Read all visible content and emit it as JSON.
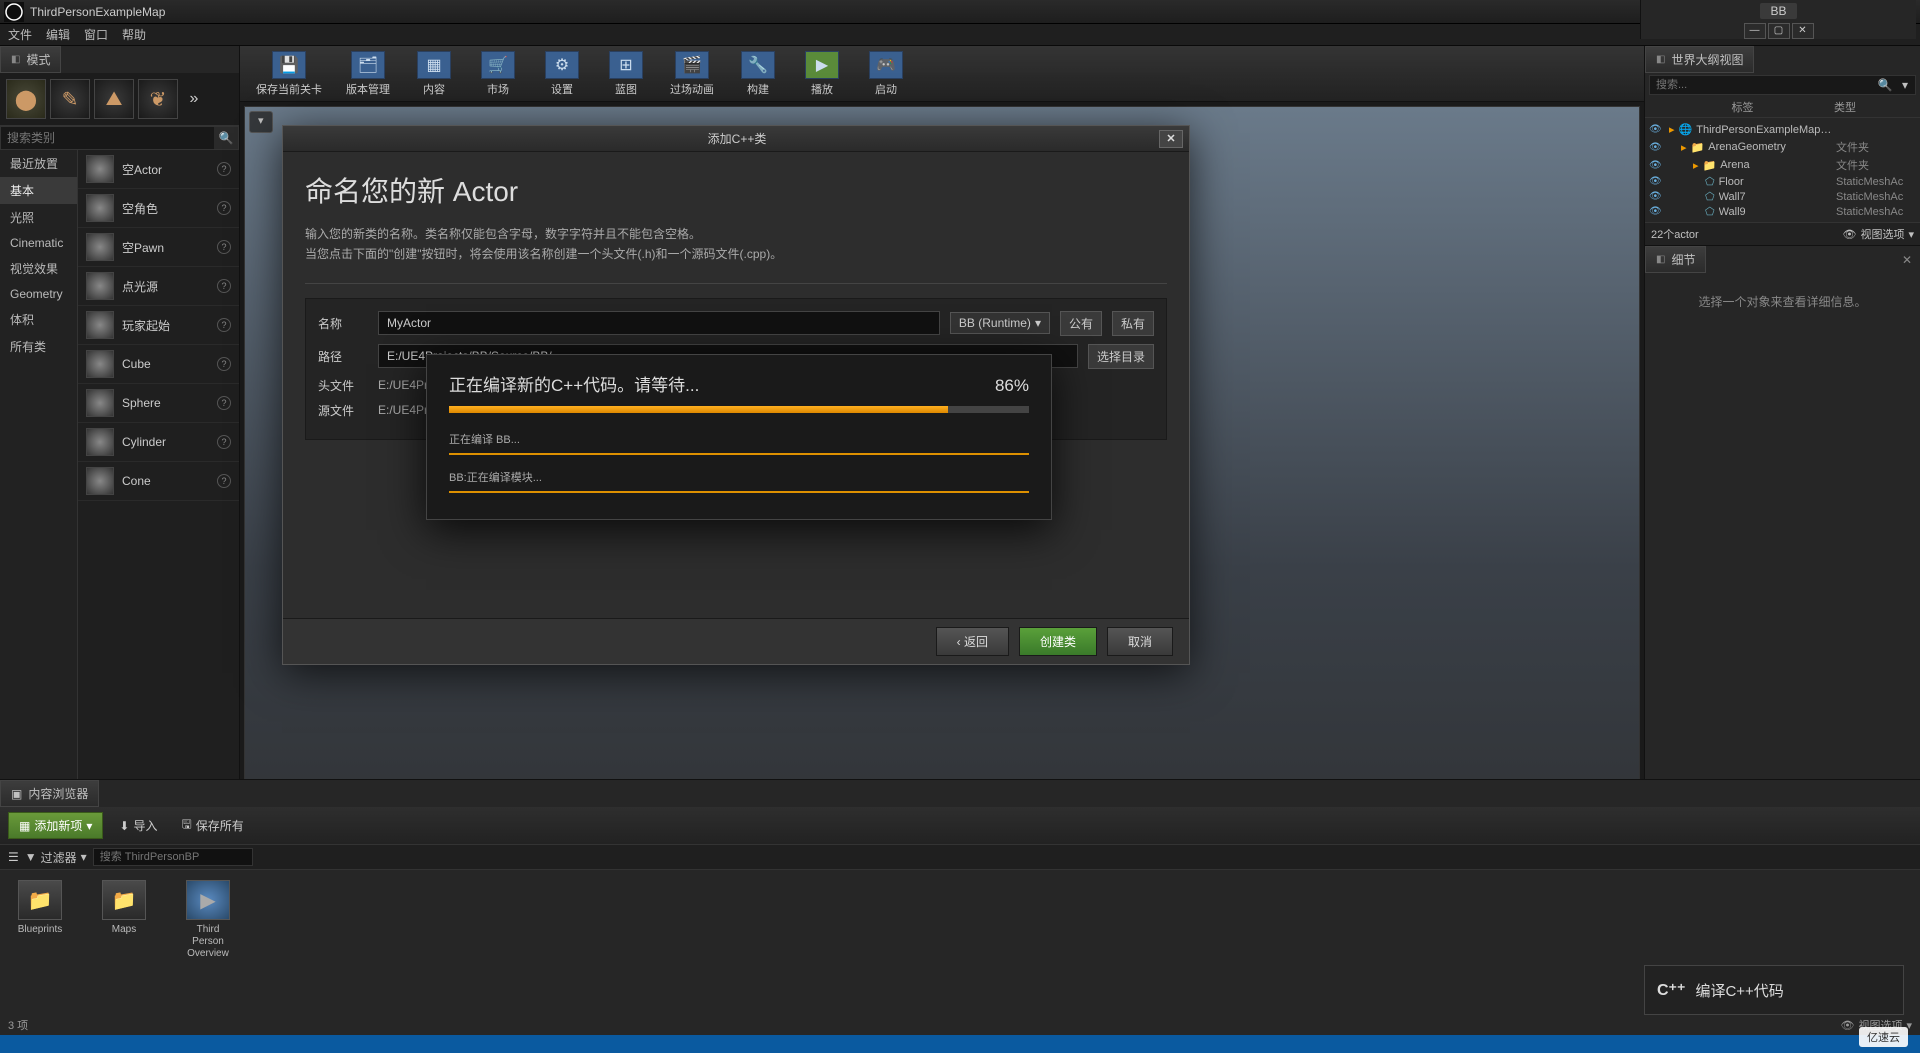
{
  "titlebar": {
    "title": "ThirdPersonExampleMap",
    "project": "BB"
  },
  "menubar": [
    "文件",
    "编辑",
    "窗口",
    "帮助"
  ],
  "left": {
    "tab": "模式",
    "searchPlaceholder": "搜索类别",
    "categories": [
      "最近放置",
      "基本",
      "光照",
      "Cinematic",
      "视觉效果",
      "Geometry",
      "体积",
      "所有类"
    ],
    "selectedCategory": "基本",
    "items": [
      "空Actor",
      "空角色",
      "空Pawn",
      "点光源",
      "玩家起始",
      "Cube",
      "Sphere",
      "Cylinder",
      "Cone"
    ]
  },
  "toolbar": [
    {
      "label": "保存当前关卡",
      "ic": "💾"
    },
    {
      "label": "版本管理",
      "ic": "🗂"
    },
    {
      "label": "内容",
      "ic": "▦"
    },
    {
      "label": "市场",
      "ic": "🛒"
    },
    {
      "label": "设置",
      "ic": "⚙"
    },
    {
      "label": "蓝图",
      "ic": "⊞"
    },
    {
      "label": "过场动画",
      "ic": "🎬"
    },
    {
      "label": "构建",
      "ic": "🔧"
    },
    {
      "label": "播放",
      "ic": "▶"
    },
    {
      "label": "启动",
      "ic": "🎮"
    }
  ],
  "outliner": {
    "tab": "世界大纲视图",
    "searchPlaceholder": "搜索...",
    "cols": {
      "label": "标签",
      "type": "类型"
    },
    "tree": [
      {
        "name": "ThirdPersonExampleMap (世界",
        "type": "",
        "depth": 0,
        "folder": true
      },
      {
        "name": "ArenaGeometry",
        "type": "文件夹",
        "depth": 1,
        "folder": true
      },
      {
        "name": "Arena",
        "type": "文件夹",
        "depth": 2,
        "folder": true
      },
      {
        "name": "Floor",
        "type": "StaticMeshAc",
        "depth": 3,
        "folder": false
      },
      {
        "name": "Wall7",
        "type": "StaticMeshAc",
        "depth": 3,
        "folder": false
      },
      {
        "name": "Wall9",
        "type": "StaticMeshAc",
        "depth": 3,
        "folder": false
      }
    ],
    "footer": {
      "count": "22个actor",
      "opts": "视图选项"
    }
  },
  "details": {
    "tab": "细节",
    "empty": "选择一个对象来查看详细信息。"
  },
  "contentBrowser": {
    "tab": "内容浏览器",
    "addNew": "添加新项",
    "import": "导入",
    "saveAll": "保存所有",
    "filters": "过滤器",
    "filterPlaceholder": "搜索 ThirdPersonBP",
    "items": [
      {
        "label": "Blueprints",
        "kind": "folder"
      },
      {
        "label": "Maps",
        "kind": "folder"
      },
      {
        "label": "Third\nPerson\nOverview",
        "kind": "asset"
      }
    ],
    "footer": {
      "count": "3 项",
      "opts": "视图选项"
    }
  },
  "dialog": {
    "title": "添加C++类",
    "heading": "命名您的新 Actor",
    "desc1": "输入您的新类的名称。类名称仅能包含字母，数字字符并且不能包含空格。",
    "desc2": "当您点击下面的\"创建\"按钮时，将会使用该名称创建一个头文件(.h)和一个源码文件(.cpp)。",
    "fields": {
      "nameLabel": "名称",
      "nameValue": "MyActor",
      "pathLabel": "路径",
      "pathValue": "E:/UE4Projects/BB/Source/BB/",
      "headerLabel": "头文件",
      "headerValue": "E:/UE4Proje",
      "sourceLabel": "源文件",
      "sourceValue": "E:/UE4Proje"
    },
    "runtime": "BB (Runtime)",
    "public": "公有",
    "private": "私有",
    "chooseDir": "选择目录",
    "back": "返回",
    "create": "创建类",
    "cancel": "取消"
  },
  "progress": {
    "message": "正在编译新的C++代码。请等待...",
    "percent": "86%",
    "percentNum": 86,
    "sub1": "正在编译 BB...",
    "sub2": "BB:正在编译模块..."
  },
  "compileToast": {
    "label": "编译C++代码"
  },
  "watermark": "亿速云"
}
